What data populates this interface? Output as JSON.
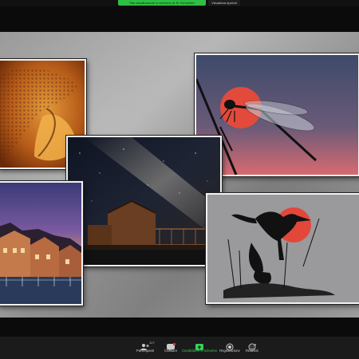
{
  "top_bar": {
    "sharing_notice": "Stai visualizzando lo schermo di JK Schneider",
    "view_options_label": "Visualizza opzioni"
  },
  "toolbar": {
    "participants": {
      "label": "Partecipanti",
      "count": "127",
      "icon": "participants-icon"
    },
    "chat": {
      "label": "Chattare",
      "badge": "",
      "icon": "chat-icon"
    },
    "share_screen": {
      "label": "Condividere lo schermo",
      "icon": "share-screen-icon"
    },
    "record": {
      "label": "Registrazione",
      "icon": "record-icon"
    },
    "reactions": {
      "label": "Reazioni",
      "icon": "reactions-icon"
    },
    "accent_color": "#37d05a"
  },
  "photos": [
    {
      "subject": "orange-abstract-texture"
    },
    {
      "subject": "dragonfly-silhouette-red-sun"
    },
    {
      "subject": "milky-way-over-barn"
    },
    {
      "subject": "seaside-houses-sunset"
    },
    {
      "subject": "heron-silhouettes-red-sun"
    }
  ]
}
